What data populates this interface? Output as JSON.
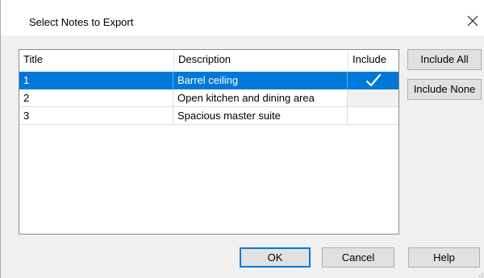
{
  "dialog": {
    "title": "Select Notes to Export"
  },
  "grid": {
    "columns": [
      "Title",
      "Description",
      "Include"
    ],
    "rows": [
      {
        "title": "1",
        "description": "Barrel ceiling",
        "include": true,
        "selected": true
      },
      {
        "title": "2",
        "description": "Open kitchen and dining area",
        "include": false,
        "selected": false
      },
      {
        "title": "3",
        "description": "Spacious master suite",
        "include": false,
        "selected": false
      }
    ]
  },
  "side_buttons": {
    "include_all": "Include All",
    "include_none": "Include None"
  },
  "footer_buttons": {
    "ok": "OK",
    "cancel": "Cancel",
    "help": "Help"
  },
  "colors": {
    "selection": "#0078d7",
    "dialog_background": "#f0f0f0",
    "button_face": "#e1e1e1"
  },
  "icons": {
    "close": "close-icon",
    "check": "checkmark-icon"
  }
}
